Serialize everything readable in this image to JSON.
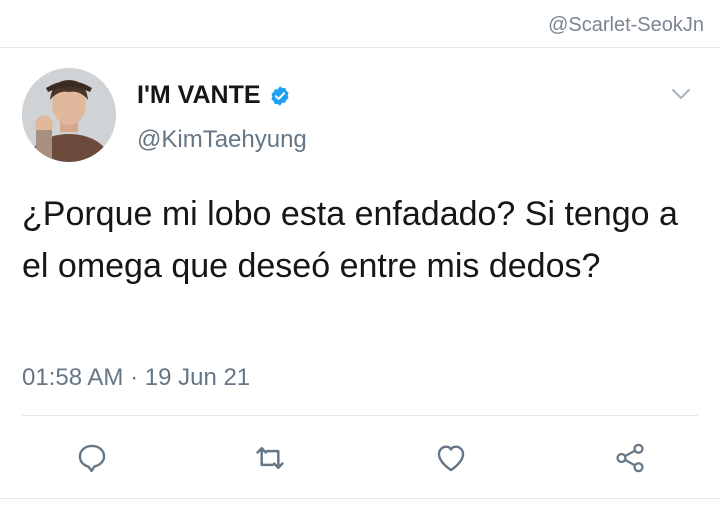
{
  "watermark": "@Scarlet-SeokJn",
  "tweet": {
    "display_name": "I'M VANTE",
    "handle": "@KimTaehyung",
    "verified": true,
    "text": "¿Porque mi lobo esta enfadado? Si tengo a el omega que deseó entre mis dedos?",
    "timestamp": "01:58 AM · 19 Jun 21"
  },
  "actions": [
    {
      "icon": "reply-icon"
    },
    {
      "icon": "retweet-icon"
    },
    {
      "icon": "like-icon"
    },
    {
      "icon": "share-icon"
    }
  ],
  "colors": {
    "verified": "#1da1f2",
    "text": "#14171a",
    "secondary": "#657786",
    "icon": "#657786"
  }
}
